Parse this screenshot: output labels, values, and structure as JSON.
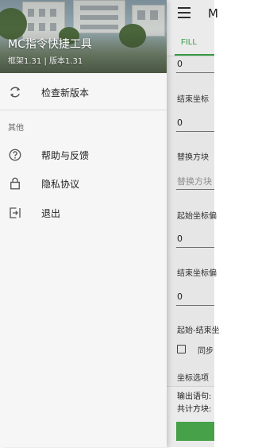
{
  "app": {
    "title": "M",
    "tabs": [
      {
        "label": "FILL",
        "active": true
      }
    ],
    "form": {
      "top_value": "0",
      "end_coord_label": "结束坐标",
      "end_coord_value": "0",
      "replace_block_label": "替换方块",
      "replace_block_placeholder": "替换方块",
      "start_offset_label": "起始坐标偏",
      "start_offset_value": "0",
      "end_offset_label": "结束坐标偏",
      "end_offset_value": "0",
      "start_end_label": "起始-结束坐",
      "sync_label": "同步",
      "coord_options_label": "坐标选项"
    },
    "output": {
      "statement_label": "输出语句:",
      "block_count_label": "共计方块:"
    }
  },
  "drawer": {
    "title": "MC指令快捷工具",
    "subtitle": "框架1.31 | 版本1.31",
    "check_update": "检查新版本",
    "section_other": "其他",
    "help_feedback": "帮助与反馈",
    "privacy": "隐私协议",
    "exit": "退出"
  },
  "colors": {
    "accent_green": "#3aa84a",
    "button_green": "#4caf50",
    "drawer_bg": "#f6f6f6"
  },
  "icons": {
    "menu": "hamburger-menu-icon",
    "check_update": "refresh-icon",
    "help": "help-circle-icon",
    "privacy": "lock-icon",
    "exit": "exit-icon"
  }
}
